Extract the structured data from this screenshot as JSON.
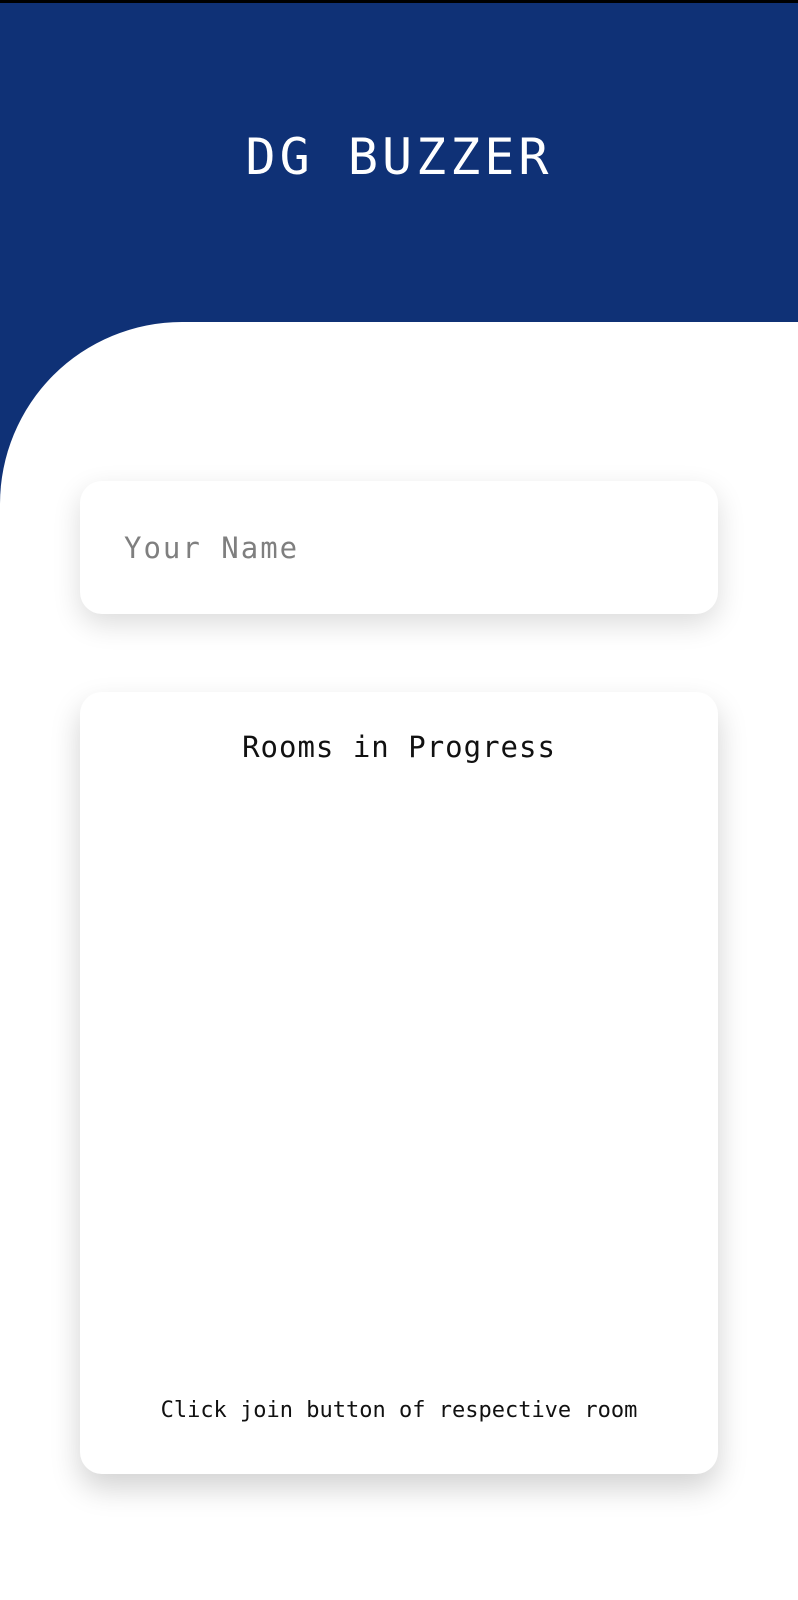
{
  "header": {
    "title": "DG BUZZER"
  },
  "name_field": {
    "placeholder": "Your Name",
    "value": ""
  },
  "rooms": {
    "title": "Rooms in Progress",
    "items": [],
    "hint": "Click join button of respective room"
  },
  "colors": {
    "primary": "#0f3176",
    "background": "#ffffff",
    "text": "#111111",
    "placeholder": "#7f7f7f"
  }
}
